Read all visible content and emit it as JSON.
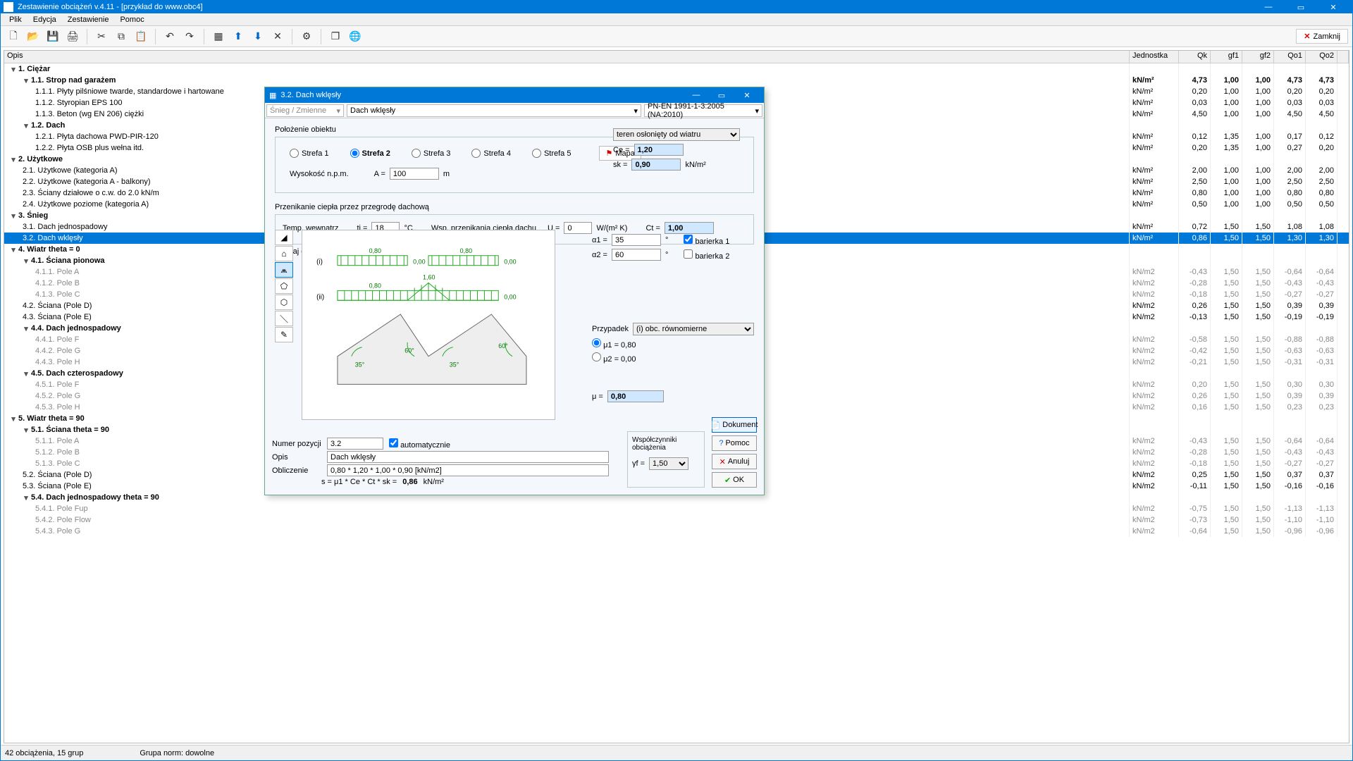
{
  "app": {
    "title": "Zestawienie obciążeń v.4.11 - [przykład do www.obc4]",
    "menu": [
      "Plik",
      "Edycja",
      "Zestawienie",
      "Pomoc"
    ],
    "close_btn": "Zamknij"
  },
  "columns": {
    "opis": "Opis",
    "jedn": "Jednostka",
    "qk": "Qk",
    "gf1": "gf1",
    "gf2": "gf2",
    "qo1": "Qo1",
    "qo2": "Qo2"
  },
  "rows": [
    {
      "lvl": 0,
      "tw": "▾",
      "bold": true,
      "t": "1.  Ciężar"
    },
    {
      "lvl": 1,
      "tw": "▾",
      "bold": true,
      "t": "1.1.  Strop nad garażem",
      "j": "kN/m²",
      "v": [
        "4,73",
        "1,00",
        "1,00",
        "4,73",
        "4,73"
      ]
    },
    {
      "lvl": 2,
      "t": "1.1.1.  Płyty pilśniowe twarde, standardowe i hartowane",
      "j": "kN/m²",
      "v": [
        "0,20",
        "1,00",
        "1,00",
        "0,20",
        "0,20"
      ]
    },
    {
      "lvl": 2,
      "t": "1.1.2.  Styropian EPS 100",
      "j": "kN/m²",
      "v": [
        "0,03",
        "1,00",
        "1,00",
        "0,03",
        "0,03"
      ]
    },
    {
      "lvl": 2,
      "t": "1.1.3.  Beton (wg EN 206) ciężki",
      "j": "kN/m²",
      "v": [
        "4,50",
        "1,00",
        "1,00",
        "4,50",
        "4,50"
      ]
    },
    {
      "lvl": 1,
      "tw": "▾",
      "bold": true,
      "t": "1.2.  Dach"
    },
    {
      "lvl": 2,
      "t": "1.2.1.  Płyta dachowa PWD-PIR-120",
      "j": "kN/m²",
      "v": [
        "0,12",
        "1,35",
        "1,00",
        "0,17",
        "0,12"
      ]
    },
    {
      "lvl": 2,
      "t": "1.2.2.  Płyta OSB plus wełna itd.",
      "j": "kN/m²",
      "v": [
        "0,20",
        "1,35",
        "1,00",
        "0,27",
        "0,20"
      ]
    },
    {
      "lvl": 0,
      "tw": "▾",
      "bold": true,
      "t": "2.  Użytkowe"
    },
    {
      "lvl": 1,
      "t": "2.1.  Użytkowe (kategoria A)",
      "j": "kN/m²",
      "v": [
        "2,00",
        "1,00",
        "1,00",
        "2,00",
        "2,00"
      ]
    },
    {
      "lvl": 1,
      "t": "2.2.  Użytkowe (kategoria A - balkony)",
      "j": "kN/m²",
      "v": [
        "2,50",
        "1,00",
        "1,00",
        "2,50",
        "2,50"
      ]
    },
    {
      "lvl": 1,
      "t": "2.3.  Ściany działowe o c.w. do 2.0 kN/m",
      "j": "kN/m²",
      "v": [
        "0,80",
        "1,00",
        "1,00",
        "0,80",
        "0,80"
      ]
    },
    {
      "lvl": 1,
      "t": "2.4.  Użytkowe poziome (kategoria A)",
      "j": "kN/m²",
      "v": [
        "0,50",
        "1,00",
        "1,00",
        "0,50",
        "0,50"
      ]
    },
    {
      "lvl": 0,
      "tw": "▾",
      "bold": true,
      "t": "3.  Śnieg"
    },
    {
      "lvl": 1,
      "t": "3.1.  Dach jednospadowy",
      "j": "kN/m²",
      "v": [
        "0,72",
        "1,50",
        "1,50",
        "1,08",
        "1,08"
      ]
    },
    {
      "lvl": 1,
      "sel": true,
      "t": "3.2.  Dach wklęsły",
      "j": "kN/m²",
      "v": [
        "0,86",
        "1,50",
        "1,50",
        "1,30",
        "1,30"
      ]
    },
    {
      "lvl": 0,
      "tw": "▾",
      "bold": true,
      "t": "4.  Wiatr theta = 0"
    },
    {
      "lvl": 1,
      "tw": "▾",
      "bold": true,
      "t": "4.1.  Ściana pionowa"
    },
    {
      "lvl": 2,
      "dim": true,
      "t": "4.1.1.  Pole A",
      "j": "kN/m2",
      "v": [
        "-0,43",
        "1,50",
        "1,50",
        "-0,64",
        "-0,64"
      ]
    },
    {
      "lvl": 2,
      "dim": true,
      "t": "4.1.2.  Pole B",
      "j": "kN/m2",
      "v": [
        "-0,28",
        "1,50",
        "1,50",
        "-0,43",
        "-0,43"
      ]
    },
    {
      "lvl": 2,
      "dim": true,
      "t": "4.1.3.  Pole C",
      "j": "kN/m2",
      "v": [
        "-0,18",
        "1,50",
        "1,50",
        "-0,27",
        "-0,27"
      ]
    },
    {
      "lvl": 1,
      "t": "4.2.  Ściana (Pole D)",
      "j": "kN/m2",
      "v": [
        "0,26",
        "1,50",
        "1,50",
        "0,39",
        "0,39"
      ]
    },
    {
      "lvl": 1,
      "t": "4.3.  Ściana (Pole E)",
      "j": "kN/m2",
      "v": [
        "-0,13",
        "1,50",
        "1,50",
        "-0,19",
        "-0,19"
      ]
    },
    {
      "lvl": 1,
      "tw": "▾",
      "bold": true,
      "t": "4.4.  Dach jednospadowy"
    },
    {
      "lvl": 2,
      "dim": true,
      "t": "4.4.1.  Pole F",
      "j": "kN/m2",
      "v": [
        "-0,58",
        "1,50",
        "1,50",
        "-0,88",
        "-0,88"
      ]
    },
    {
      "lvl": 2,
      "dim": true,
      "t": "4.4.2.  Pole G",
      "j": "kN/m2",
      "v": [
        "-0,42",
        "1,50",
        "1,50",
        "-0,63",
        "-0,63"
      ]
    },
    {
      "lvl": 2,
      "dim": true,
      "t": "4.4.3.  Pole H",
      "j": "kN/m2",
      "v": [
        "-0,21",
        "1,50",
        "1,50",
        "-0,31",
        "-0,31"
      ]
    },
    {
      "lvl": 1,
      "tw": "▾",
      "bold": true,
      "t": "4.5.  Dach czterospadowy"
    },
    {
      "lvl": 2,
      "dim": true,
      "t": "4.5.1.  Pole F",
      "j": "kN/m2",
      "v": [
        "0,20",
        "1,50",
        "1,50",
        "0,30",
        "0,30"
      ]
    },
    {
      "lvl": 2,
      "dim": true,
      "t": "4.5.2.  Pole G",
      "j": "kN/m2",
      "v": [
        "0,26",
        "1,50",
        "1,50",
        "0,39",
        "0,39"
      ]
    },
    {
      "lvl": 2,
      "dim": true,
      "t": "4.5.3.  Pole H",
      "j": "kN/m2",
      "v": [
        "0,16",
        "1,50",
        "1,50",
        "0,23",
        "0,23"
      ]
    },
    {
      "lvl": 0,
      "tw": "▾",
      "bold": true,
      "t": "5.  Wiatr theta = 90"
    },
    {
      "lvl": 1,
      "tw": "▾",
      "bold": true,
      "t": "5.1.  Ściana theta = 90"
    },
    {
      "lvl": 2,
      "dim": true,
      "t": "5.1.1.  Pole A",
      "j": "kN/m2",
      "v": [
        "-0,43",
        "1,50",
        "1,50",
        "-0,64",
        "-0,64"
      ]
    },
    {
      "lvl": 2,
      "dim": true,
      "t": "5.1.2.  Pole B",
      "j": "kN/m2",
      "v": [
        "-0,28",
        "1,50",
        "1,50",
        "-0,43",
        "-0,43"
      ]
    },
    {
      "lvl": 2,
      "dim": true,
      "t": "5.1.3.  Pole C",
      "j": "kN/m2",
      "v": [
        "-0,18",
        "1,50",
        "1,50",
        "-0,27",
        "-0,27"
      ]
    },
    {
      "lvl": 1,
      "t": "5.2.  Ściana (Pole D)",
      "j": "kN/m2",
      "v": [
        "0,25",
        "1,50",
        "1,50",
        "0,37",
        "0,37"
      ]
    },
    {
      "lvl": 1,
      "t": "5.3.  Ściana (Pole E)",
      "j": "kN/m2",
      "v": [
        "-0,11",
        "1,50",
        "1,50",
        "-0,16",
        "-0,16"
      ]
    },
    {
      "lvl": 1,
      "tw": "▾",
      "bold": true,
      "t": "5.4.  Dach jednospadowy theta = 90"
    },
    {
      "lvl": 2,
      "dim": true,
      "t": "5.4.1.  Pole Fup",
      "j": "kN/m2",
      "v": [
        "-0,75",
        "1,50",
        "1,50",
        "-1,13",
        "-1,13"
      ]
    },
    {
      "lvl": 2,
      "dim": true,
      "t": "5.4.2.  Pole Flow",
      "j": "kN/m2",
      "v": [
        "-0,73",
        "1,50",
        "1,50",
        "-1,10",
        "-1,10"
      ]
    },
    {
      "lvl": 2,
      "dim": true,
      "t": "5.4.3.  Pole G",
      "j": "kN/m2",
      "v": [
        "-0,64",
        "1,50",
        "1,50",
        "-0,96",
        "-0,96"
      ]
    }
  ],
  "status": {
    "left": "42 obciążenia, 15 grup",
    "mid": "Grupa norm: dowolne"
  },
  "dialog": {
    "title": "3.2.  Dach wklęsły",
    "combo1": "Śnieg / Zmienne",
    "combo2": "Dach wklęsły",
    "combo3": "PN-EN 1991-1-3:2005 (NA:2010)",
    "loc_label": "Położenie obiektu",
    "zones": [
      "Strefa 1",
      "Strefa 2",
      "Strefa 3",
      "Strefa 4",
      "Strefa 5"
    ],
    "zone_selected": 1,
    "map_btn": "Mapa",
    "alt_label": "Wysokość n.p.m.",
    "alt_A": "A =",
    "alt_val": "100",
    "alt_unit": "m",
    "terrain": "teren osłonięty od wiatru",
    "ce_label": "Ce =",
    "ce_val": "1,20",
    "sk_label": "sk =",
    "sk_val": "0,90",
    "sk_unit": "kN/m²",
    "heat_section": "Przenikanie ciepła przez przegrodę dachową",
    "ti_label": "Temp. wewnątrz",
    "ti_sym": "ti =",
    "ti_val": "18",
    "ti_unit": "°C",
    "u_label": "Wsp. przenikania ciepła dachu",
    "u_sym": "U =",
    "u_val": "0",
    "u_unit": "W/(m² K)",
    "ct_label": "Ct =",
    "ct_val": "1,00",
    "roof_section": "Rodzaj dachu",
    "a1_label": "α1 =",
    "a1_val": "35",
    "deg": "°",
    "a2_label": "α2 =",
    "a2_val": "60",
    "bar1": "barierka 1",
    "bar2": "barierka 2",
    "case_label": "Przypadek",
    "case_val": "(i) obc. równomierne",
    "mu1": "μ1 = 0,80",
    "mu2": "μ2 = 0,00",
    "mu_label": "μ =",
    "mu_val": "0,80",
    "pos_label": "Numer pozycji",
    "pos_val": "3.2",
    "auto": "automatycznie",
    "opis_label": "Opis",
    "opis_val": "Dach wklęsły",
    "calc_label": "Obliczenie",
    "calc_val": "0,80 * 1,20 * 1,00 * 0,90 [kN/m2]",
    "formula": "s = μ1 * Ce * Ct * sk = ",
    "formula_val": "0,86",
    "formula_unit": " kN/m²",
    "coef_label": "Współczynniki obciążenia",
    "gf_label": "γf =",
    "gf_val": "1,50",
    "btn_doc": "Dokument",
    "btn_help": "Pomoc",
    "btn_cancel": "Anuluj",
    "btn_ok": "OK",
    "diagram": {
      "i": "(i)",
      "ii": "(ii)",
      "v": [
        "0,80",
        "0,00",
        "0,80",
        "0,00",
        "0,80",
        "1,60",
        "0,00",
        "0,00"
      ],
      "ang": [
        "35°",
        "60°",
        "35°",
        "60°"
      ]
    }
  }
}
